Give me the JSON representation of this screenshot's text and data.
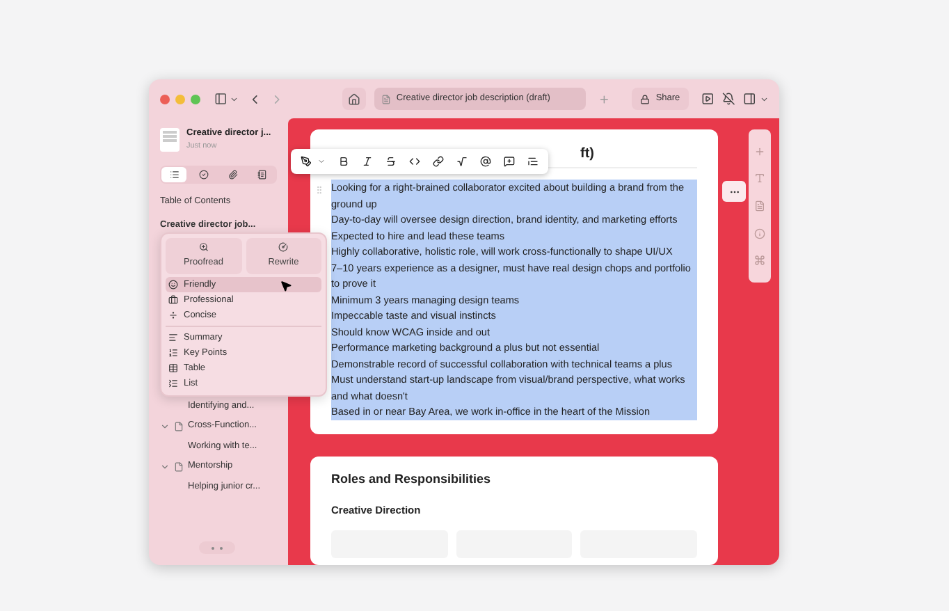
{
  "window": {
    "tab_title": "Creative director job description (draft)",
    "share": "Share"
  },
  "sidebar": {
    "doc_title": "Creative director j...",
    "doc_time": "Just now",
    "view_tabs": [
      {
        "kind": "toc",
        "selected": true
      },
      {
        "kind": "check",
        "selected": false
      },
      {
        "kind": "clip",
        "selected": false
      },
      {
        "kind": "note",
        "selected": false
      }
    ],
    "toc_heading": "Table of Contents",
    "toc_top": "Creative director job...",
    "toc_items": [
      {
        "kind": "leaf",
        "label": "Identifying and..."
      },
      {
        "kind": "section",
        "label": "Cross-Function...",
        "expanded": true,
        "children": [
          {
            "label": "Working with te..."
          }
        ]
      },
      {
        "kind": "section",
        "label": "Mentorship",
        "expanded": true,
        "children": [
          {
            "label": "Helping junior cr..."
          }
        ]
      }
    ]
  },
  "ai_menu": {
    "actions": [
      {
        "kind": "proofread",
        "label": "Proofread"
      },
      {
        "kind": "rewrite",
        "label": "Rewrite"
      }
    ],
    "tones": [
      {
        "kind": "smile",
        "label": "Friendly",
        "selected": true
      },
      {
        "kind": "briefcase",
        "label": "Professional",
        "selected": false
      },
      {
        "kind": "divide",
        "label": "Concise",
        "selected": false
      }
    ],
    "formats": [
      {
        "kind": "summary",
        "label": "Summary"
      },
      {
        "kind": "points",
        "label": "Key Points"
      },
      {
        "kind": "table",
        "label": "Table"
      },
      {
        "kind": "list",
        "label": "List"
      }
    ]
  },
  "document": {
    "title": "ft)",
    "lines": [
      "Looking for a right-brained collaborator excited about building a brand from the ground up",
      "Day-to-day will oversee design direction, brand identity, and marketing efforts",
      "Expected to hire and lead these teams",
      "Highly collaborative, holistic role, will work cross-functionally to shape UI/UX",
      "7–10 years experience as a designer, must have real design chops and portfolio to prove it",
      "Minimum 3 years managing design teams",
      "Impeccable taste and visual instincts",
      "Should know WCAG inside and out",
      "Performance marketing background a plus but not essential",
      "Demonstrable record of successful collaboration with technical teams a plus",
      "Must understand start-up landscape from visual/brand perspective, what works and what doesn't",
      "Based in or near Bay Area, we work in-office in the heart of the Mission"
    ],
    "section_title": "Roles and Responsibilities",
    "subsection_title": "Creative Direction"
  }
}
